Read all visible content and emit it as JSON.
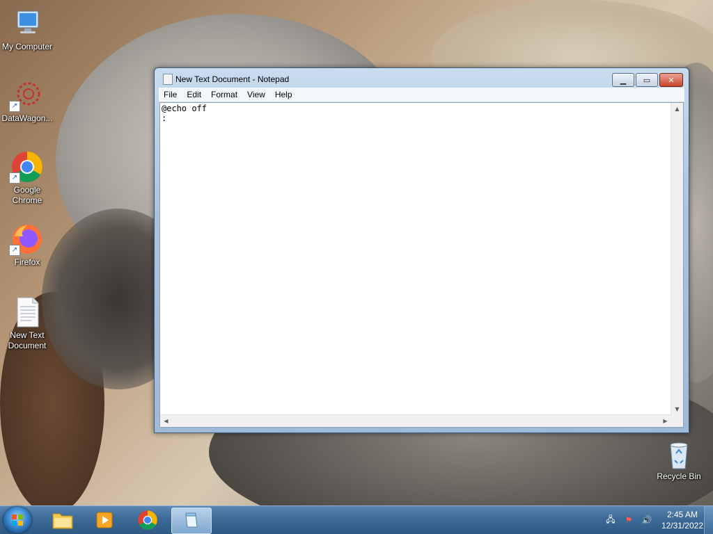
{
  "desktop": {
    "icons": [
      {
        "label": "My Computer"
      },
      {
        "label": "DataWagon..."
      },
      {
        "label": "Google Chrome"
      },
      {
        "label": "Firefox"
      },
      {
        "label": "New Text Document"
      },
      {
        "label": "Recycle Bin"
      }
    ]
  },
  "notepad": {
    "title": "New Text Document - Notepad",
    "menu": [
      "File",
      "Edit",
      "Format",
      "View",
      "Help"
    ],
    "content": "@echo off\n:"
  },
  "taskbar": {
    "clock_time": "2:45 AM",
    "clock_date": "12/31/2022"
  }
}
